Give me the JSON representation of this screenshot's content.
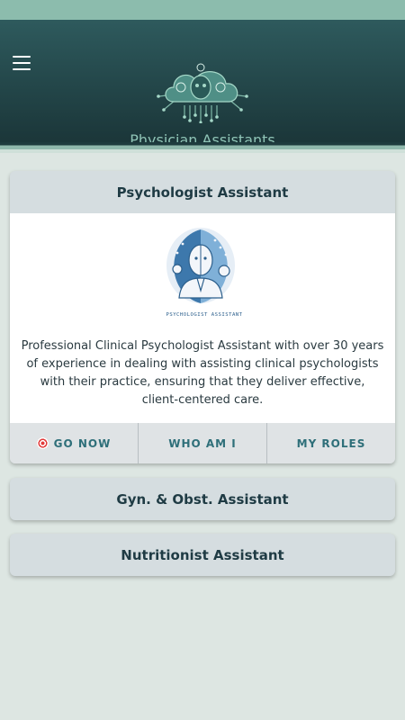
{
  "app": {
    "title": "Physician Assistants"
  },
  "cards": [
    {
      "title": "Psychologist Assistant",
      "image_caption": "PSYCHOLOGIST ASSISTANT",
      "description": "Professional Clinical Psychologist Assistant with over 30 years of experience in dealing with assisting clinical psychologists with their practice, ensuring that they deliver effective, client-centered care.",
      "actions": {
        "go_now": "GO NOW",
        "who_am_i": "WHO AM I",
        "my_roles": "MY ROLES"
      }
    },
    {
      "title": "Gyn. & Obst. Assistant"
    },
    {
      "title": "Nutritionist Assistant"
    }
  ],
  "colors": {
    "header": "#234649",
    "accent": "#8fc4b6",
    "card": "#d5dde0",
    "background": "#dde6e2"
  },
  "icons": {
    "menu": "hamburger-menu-icon",
    "go_now": "target-icon"
  }
}
